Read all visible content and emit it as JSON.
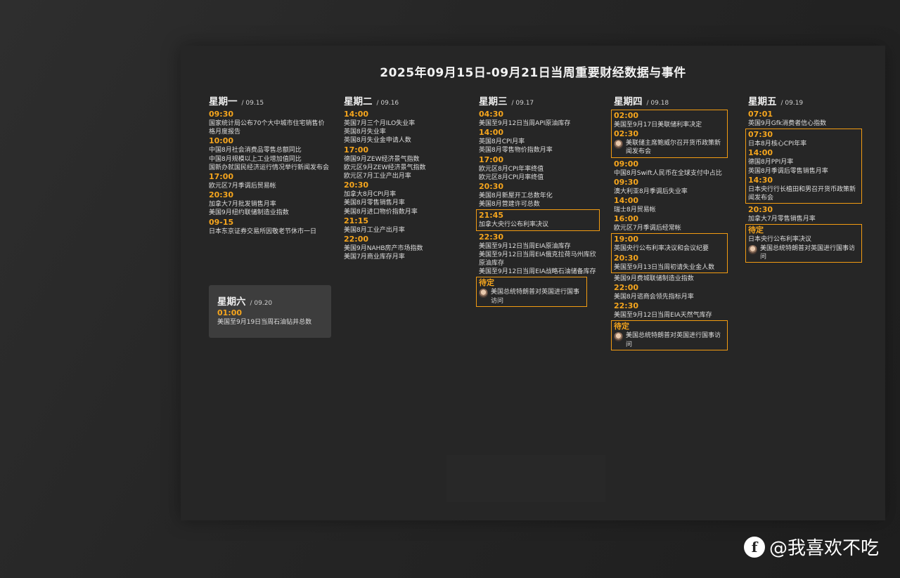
{
  "title": "2025年09月15日-09月21日当周重要财经数据与事件",
  "monday": {
    "day": "星期一",
    "date": "/ 09.15",
    "events": [
      {
        "time": "09:30",
        "lines": [
          "国家统计局公布70个大中城市住宅销售价格月度报告"
        ]
      },
      {
        "time": "10:00",
        "lines": [
          "中国8月社会消费品零售总额同比",
          "中国8月规模以上工业增加值同比",
          "国新办就国民经济运行情况举行新闻发布会"
        ]
      },
      {
        "time": "17:00",
        "lines": [
          "欧元区7月季调后贸易帐"
        ]
      },
      {
        "time": "20:30",
        "lines": [
          "加拿大7月批发销售月率",
          "美国9月纽约联储制造业指数"
        ]
      },
      {
        "time": "09-15",
        "lines": [
          "日本东京证券交易所因敬老节休市一日"
        ]
      }
    ]
  },
  "tuesday": {
    "day": "星期二",
    "date": "/ 09.16",
    "events": [
      {
        "time": "14:00",
        "lines": [
          "英国7月三个月ILO失业率",
          "英国8月失业率",
          "英国8月失业金申请人数"
        ]
      },
      {
        "time": "17:00",
        "lines": [
          "德国9月ZEW经济景气指数",
          "欧元区9月ZEW经济景气指数",
          "欧元区7月工业产出月率"
        ]
      },
      {
        "time": "20:30",
        "lines": [
          "加拿大8月CPI月率",
          "美国8月零售销售月率",
          "美国8月进口物价指数月率"
        ]
      },
      {
        "time": "21:15",
        "lines": [
          "美国8月工业产出月率"
        ]
      },
      {
        "time": "22:00",
        "lines": [
          "美国9月NAHB房产市场指数",
          "美国7月商业库存月率"
        ]
      }
    ]
  },
  "wednesday": {
    "day": "星期三",
    "date": "/ 09.17",
    "events": [
      {
        "time": "04:30",
        "lines": [
          "美国至9月12日当周API原油库存"
        ]
      },
      {
        "time": "14:00",
        "lines": [
          "英国8月CPI月率",
          "英国8月零售物价指数月率"
        ]
      },
      {
        "time": "17:00",
        "lines": [
          "欧元区8月CPI年率终值",
          "欧元区8月CPI月率终值"
        ]
      },
      {
        "time": "20:30",
        "lines": [
          "美国8月新屋开工总数年化",
          "美国8月营建许可总数"
        ]
      },
      {
        "time": "21:45",
        "lines": [
          "加拿大央行公布利率决议"
        ],
        "highlight": true
      },
      {
        "time": "22:30",
        "lines": [
          "美国至9月12日当周EIA原油库存",
          "美国至9月12日当周EIA俄克拉荷马州库欣原油库存",
          "美国至9月12日当周EIA战略石油储备库存"
        ]
      },
      {
        "time": "待定",
        "lines": [
          "美国总统特朗普对英国进行国事访问"
        ],
        "highlight": true,
        "avatar": true
      }
    ]
  },
  "thursday": {
    "day": "星期四",
    "date": "/ 09.18",
    "events": [
      {
        "time": "02:00",
        "lines": [
          "美国至9月17日美联储利率决定"
        ],
        "group": "a"
      },
      {
        "time": "02:30",
        "lines": [
          "美联储主席鲍威尔召开货币政策新闻发布会"
        ],
        "group": "a",
        "avatar": true
      },
      {
        "time": "09:00",
        "lines": [
          "中国8月Swift人民币在全球支付中占比"
        ]
      },
      {
        "time": "09:30",
        "lines": [
          "澳大利亚8月季调后失业率"
        ]
      },
      {
        "time": "14:00",
        "lines": [
          "瑞士8月贸易帐"
        ]
      },
      {
        "time": "16:00",
        "lines": [
          "欧元区7月季调后经常帐"
        ]
      },
      {
        "time": "19:00",
        "lines": [
          "英国央行公布利率决议和会议纪要"
        ],
        "group": "b"
      },
      {
        "time": "20:30",
        "lines": [
          "美国至9月13日当周初请失业金人数"
        ],
        "group": "b"
      },
      {
        "time": "",
        "lines": [
          "美国9月费城联储制造业指数"
        ]
      },
      {
        "time": "22:00",
        "lines": [
          "美国8月谘商会领先指标月率"
        ]
      },
      {
        "time": "22:30",
        "lines": [
          "美国至9月12日当周EIA天然气库存"
        ]
      },
      {
        "time": "待定",
        "lines": [
          "美国总统特朗普对英国进行国事访问"
        ],
        "group": "c",
        "avatar": true
      }
    ]
  },
  "friday": {
    "day": "星期五",
    "date": "/ 09.19",
    "events": [
      {
        "time": "07:01",
        "lines": [
          "英国9月Gfk消费者信心指数"
        ]
      },
      {
        "time": "07:30",
        "lines": [
          "日本8月核心CPI年率"
        ],
        "group": "a"
      },
      {
        "time": "14:00",
        "lines": [
          "德国8月PPI月率",
          "英国8月季调后零售销售月率"
        ],
        "group": "a"
      },
      {
        "time": "14:30",
        "lines": [
          "日本央行行长植田和男召开货币政策新闻发布会"
        ],
        "group": "a"
      },
      {
        "time": "20:30",
        "lines": [
          "加拿大7月零售销售月率"
        ]
      },
      {
        "time": "待定",
        "lines": [
          "日本央行公布利率决议"
        ],
        "group": "b"
      },
      {
        "time": "",
        "lines": [
          "美国总统特朗普对英国进行国事访问"
        ],
        "group": "b",
        "avatar": true
      }
    ]
  },
  "saturday": {
    "day": "星期六",
    "date": "/ 09.20",
    "events": [
      {
        "time": "01:00",
        "lines": [
          "美国至9月19日当周石油钻井总数"
        ]
      }
    ]
  },
  "watermark": {
    "text": "@我喜欢不吃",
    "logo": "f"
  },
  "colors": {
    "accent": "#f39c12",
    "panel": "#262626",
    "card": "#3d3d3d"
  }
}
